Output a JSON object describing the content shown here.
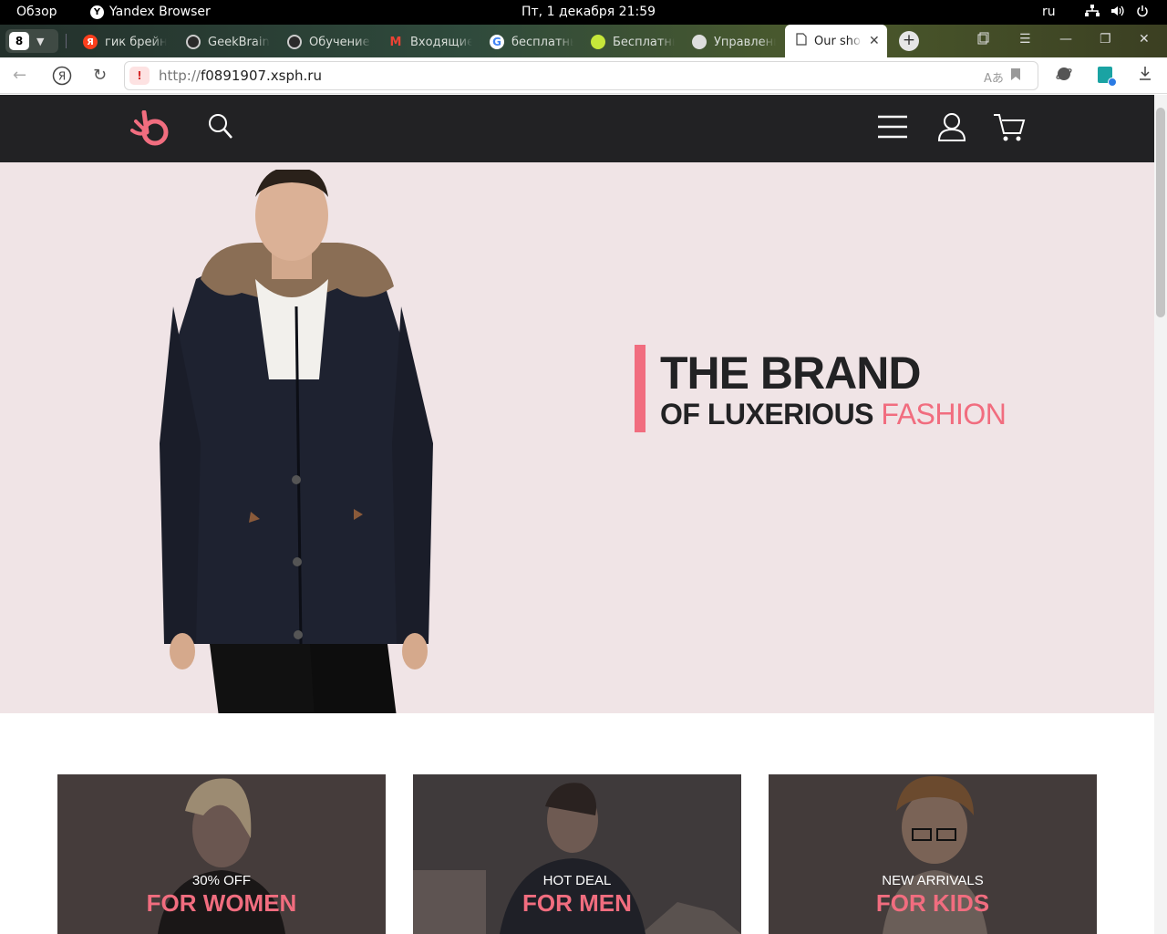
{
  "os": {
    "overview": "Обзор",
    "app_name": "Yandex Browser",
    "clock": "Пт, 1 декабря  21:59",
    "lang": "ru"
  },
  "browser": {
    "tab_count": "8",
    "tabs": [
      {
        "label": "гик брейнс",
        "favicon": "yandex-icon"
      },
      {
        "label": "GeekBrains",
        "favicon": "geekbrains-icon"
      },
      {
        "label": "Обучение",
        "favicon": "geekbrains-icon"
      },
      {
        "label": "Входящие",
        "favicon": "gmail-icon"
      },
      {
        "label": "бесплатный",
        "favicon": "google-icon"
      },
      {
        "label": "Бесплатный",
        "favicon": "tennis-ball-icon"
      },
      {
        "label": "Управление",
        "favicon": "hosting-icon"
      },
      {
        "label": "Our shop",
        "favicon": "page-icon",
        "active": true
      }
    ],
    "url_scheme": "http://",
    "url_host": "f0891907.xsph.ru",
    "colors": {
      "warning": "#d62a2a"
    }
  },
  "site": {
    "accent_color": "#f16d7f",
    "header_color": "#222224",
    "hero": {
      "title": "THE BRAND",
      "subtitle_dark": "OF LUXERIOUS ",
      "subtitle_accent": "FASHION",
      "background": "#f0e4e6"
    },
    "categories": [
      {
        "small": "30% OFF",
        "big": "FOR WOMEN"
      },
      {
        "small": "HOT DEAL",
        "big": "FOR MEN"
      },
      {
        "small": "NEW ARRIVALS",
        "big": "FOR KIDS"
      }
    ]
  }
}
